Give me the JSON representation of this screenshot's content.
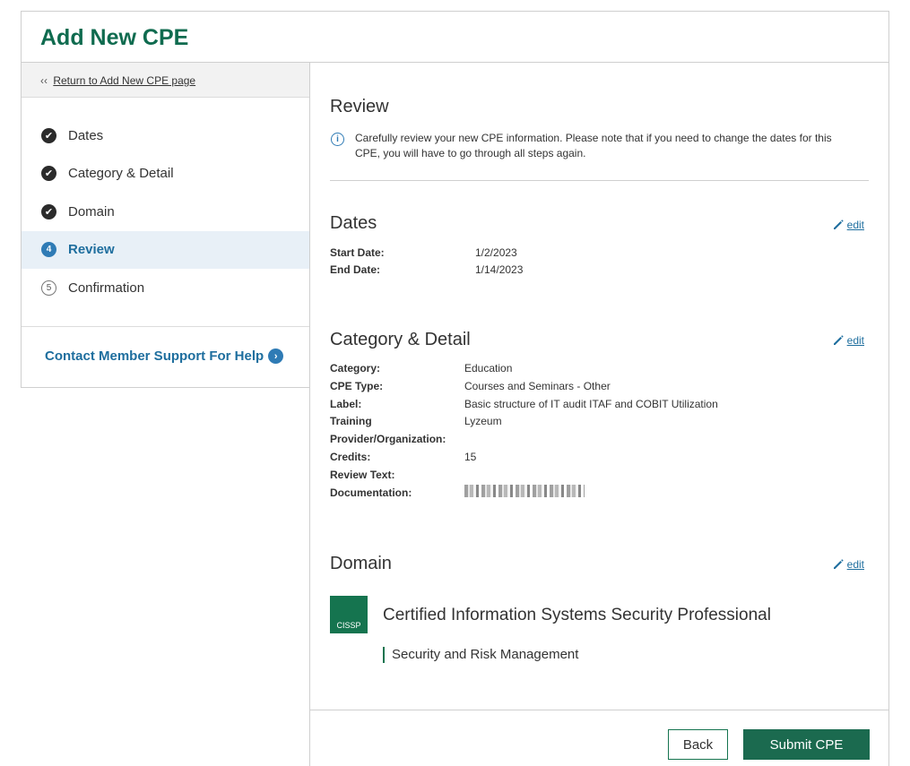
{
  "page": {
    "title": "Add New CPE"
  },
  "sidebar": {
    "return_prefix": "‹‹",
    "return_link": "Return to Add New CPE page",
    "steps": [
      {
        "label": "Dates",
        "state": "done",
        "marker": "✔"
      },
      {
        "label": "Category & Detail",
        "state": "done",
        "marker": "✔"
      },
      {
        "label": "Domain",
        "state": "done",
        "marker": "✔"
      },
      {
        "label": "Review",
        "state": "current",
        "marker": "4"
      },
      {
        "label": "Confirmation",
        "state": "future",
        "marker": "5"
      }
    ],
    "help_label": "Contact Member Support For Help"
  },
  "review": {
    "title": "Review",
    "info_text": "Carefully review your new CPE information. Please note that if you need to change the dates for this CPE, you will have to go through all steps again."
  },
  "edit_label": "edit",
  "dates": {
    "title": "Dates",
    "start_label": "Start Date:",
    "start_value": "1/2/2023",
    "end_label": "End Date:",
    "end_value": "1/14/2023"
  },
  "category": {
    "title": "Category & Detail",
    "rows": [
      {
        "label": "Category:",
        "value": "Education"
      },
      {
        "label": "CPE Type:",
        "value": "Courses and Seminars - Other"
      },
      {
        "label": "Label:",
        "value": "Basic structure of IT audit ITAF and COBIT Utilization"
      },
      {
        "label": "Training Provider/Organization:",
        "value": "Lyzeum"
      },
      {
        "label": "Credits:",
        "value": "15"
      },
      {
        "label": "Review Text:",
        "value": ""
      },
      {
        "label": "Documentation:",
        "value": ""
      }
    ]
  },
  "domain": {
    "title": "Domain",
    "logo_text": "CISSP",
    "certification": "Certified Information Systems Security Professional",
    "subdomain": "Security and Risk Management"
  },
  "footer": {
    "back_label": "Back",
    "submit_label": "Submit CPE"
  },
  "colors": {
    "brand_green": "#0f6b4f",
    "link_blue": "#1e6e9e",
    "active_step_bg": "#e8f0f7"
  }
}
